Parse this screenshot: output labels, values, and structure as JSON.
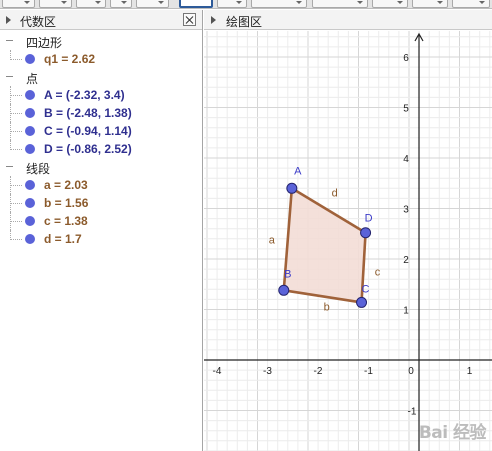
{
  "algebra_view": {
    "title": "代数区",
    "groups": [
      {
        "label": "四边形",
        "items": [
          {
            "text": "q1 = 2.62",
            "color": "#8b5a2b"
          }
        ]
      },
      {
        "label": "点",
        "items": [
          {
            "text": "A = (-2.32, 3.4)",
            "color": "#2f2f8f"
          },
          {
            "text": "B = (-2.48, 1.38)",
            "color": "#2f2f8f"
          },
          {
            "text": "C = (-0.94, 1.14)",
            "color": "#2f2f8f"
          },
          {
            "text": "D = (-0.86, 2.52)",
            "color": "#2f2f8f"
          }
        ]
      },
      {
        "label": "线段",
        "items": [
          {
            "text": "a = 2.03",
            "color": "#8b5a2b"
          },
          {
            "text": "b = 1.56",
            "color": "#8b5a2b"
          },
          {
            "text": "c = 1.38",
            "color": "#8b5a2b"
          },
          {
            "text": "d = 1.7",
            "color": "#8b5a2b"
          }
        ]
      }
    ]
  },
  "graphics_view": {
    "title": "绘图区",
    "x_ticks": [
      "-4",
      "-3",
      "-2",
      "-1",
      "0",
      "1"
    ],
    "y_ticks": [
      "1",
      "2",
      "3",
      "4",
      "5",
      "6"
    ],
    "y_neg_tick": "-1",
    "points": [
      {
        "name": "A",
        "x": -2.32,
        "y": 3.4
      },
      {
        "name": "B",
        "x": -2.48,
        "y": 1.38
      },
      {
        "name": "C",
        "x": -0.94,
        "y": 1.14
      },
      {
        "name": "D",
        "x": -0.86,
        "y": 2.52
      }
    ],
    "segments": [
      {
        "name": "a",
        "from": "A",
        "to": "B"
      },
      {
        "name": "b",
        "from": "B",
        "to": "C"
      },
      {
        "name": "c",
        "from": "C",
        "to": "D"
      },
      {
        "name": "d",
        "from": "D",
        "to": "A"
      }
    ],
    "colors": {
      "point": "#5a62d8",
      "segment": "#a0623a",
      "fill": "#f3ddd6",
      "grid_minor": "#ececec",
      "grid_major": "#d6d6d6"
    }
  },
  "watermark": "Bai 经验"
}
